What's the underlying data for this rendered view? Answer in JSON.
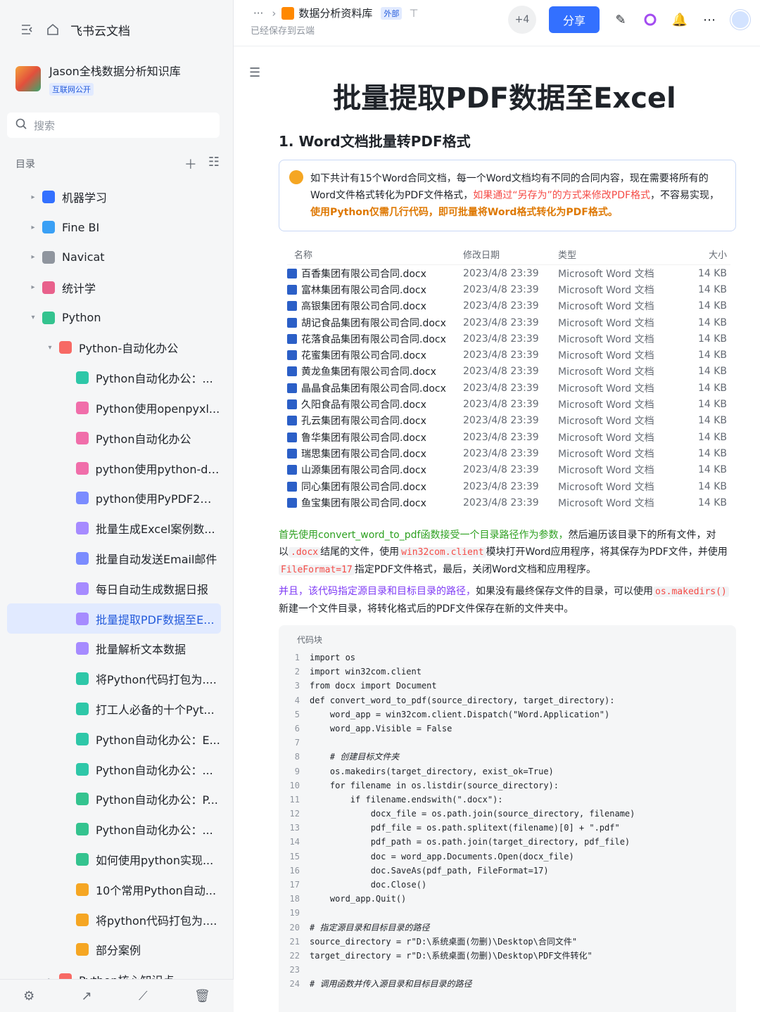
{
  "sidebar": {
    "app_name": "飞书云文档",
    "kb_name": "Jason全栈数据分析知识库",
    "kb_badge": "互联网公开",
    "search_placeholder": "搜索",
    "toc_label": "目录",
    "items": [
      {
        "label": "机器学习",
        "color": "#3370ff",
        "arrow": "▸",
        "depth": 0
      },
      {
        "label": "Fine BI",
        "color": "#3aa0f5",
        "arrow": "▸",
        "depth": 0
      },
      {
        "label": "Navicat",
        "color": "#8f959e",
        "arrow": "▸",
        "depth": 0
      },
      {
        "label": "统计学",
        "color": "#e8618c",
        "arrow": "▸",
        "depth": 0
      },
      {
        "label": "Python",
        "color": "#34c38f",
        "arrow": "▾",
        "depth": 0
      },
      {
        "label": "Python-自动化办公",
        "color": "#f76964",
        "arrow": "▾",
        "depth": 1
      },
      {
        "label": "Python自动化办公：...",
        "color": "#2ec7a8",
        "arrow": "",
        "depth": 2
      },
      {
        "label": "Python使用openpyxl...",
        "color": "#f06eaa",
        "arrow": "",
        "depth": 2
      },
      {
        "label": "Python自动化办公",
        "color": "#f06eaa",
        "arrow": "",
        "depth": 2
      },
      {
        "label": "python使用python-do...",
        "color": "#f06eaa",
        "arrow": "",
        "depth": 2
      },
      {
        "label": "python使用PyPDF2和...",
        "color": "#7b8cff",
        "arrow": "",
        "depth": 2
      },
      {
        "label": "批量生成Excel案例数...",
        "color": "#a68bff",
        "arrow": "",
        "depth": 2
      },
      {
        "label": "批量自动发送Email邮件",
        "color": "#7b8cff",
        "arrow": "",
        "depth": 2
      },
      {
        "label": "每日自动生成数据日报",
        "color": "#a68bff",
        "arrow": "",
        "depth": 2
      },
      {
        "label": "批量提取PDF数据至E...",
        "color": "#a68bff",
        "arrow": "",
        "depth": 2,
        "active": true
      },
      {
        "label": "批量解析文本数据",
        "color": "#a68bff",
        "arrow": "",
        "depth": 2
      },
      {
        "label": "将Python代码打包为....",
        "color": "#2ec7a8",
        "arrow": "",
        "depth": 2
      },
      {
        "label": "打工人必备的十个Pyt...",
        "color": "#2ec7a8",
        "arrow": "",
        "depth": 2
      },
      {
        "label": "Python自动化办公：E...",
        "color": "#2ec7a8",
        "arrow": "",
        "depth": 2
      },
      {
        "label": "Python自动化办公：...",
        "color": "#2ec7a8",
        "arrow": "",
        "depth": 2
      },
      {
        "label": "Python自动化办公：P...",
        "color": "#34c38f",
        "arrow": "",
        "depth": 2
      },
      {
        "label": "Python自动化办公：...",
        "color": "#34c38f",
        "arrow": "",
        "depth": 2
      },
      {
        "label": "如何使用python实现...",
        "color": "#34c38f",
        "arrow": "",
        "depth": 2
      },
      {
        "label": "10个常用Python自动...",
        "color": "#f5a623",
        "arrow": "",
        "depth": 2
      },
      {
        "label": "将python代码打包为....",
        "color": "#f5a623",
        "arrow": "",
        "depth": 2
      },
      {
        "label": "部分案例",
        "color": "#f5a623",
        "arrow": "",
        "depth": 2
      },
      {
        "label": "Python核心知识点",
        "color": "#f76964",
        "arrow": "▸",
        "depth": 1
      }
    ]
  },
  "header": {
    "breadcrumb_dots": "···",
    "doc_title": "数据分析资料库",
    "ext_badge": "外部",
    "saved": "已经保存到云端",
    "collaborators": "+4",
    "share": "分享"
  },
  "doc": {
    "title": "批量提取PDF数据至Excel",
    "h2": "1. Word文档批量转PDF格式",
    "callout": {
      "t1": "如下共计有15个Word合同文档，每一个Word文档均有不同的合同内容，现在需要将所有的Word文件格式转化为PDF文件格式，",
      "t2": "如果通过“另存为”的方式来修改PDF格式",
      "t3": "，不容易实现，",
      "t4": "使用Python仅需几行代码，即可批量将Word格式转化为PDF格式。"
    },
    "file_headers": {
      "name": "名称",
      "date": "修改日期",
      "type": "类型",
      "size": "大小"
    },
    "files": [
      {
        "name": "百香集团有限公司合同.docx",
        "date": "2023/4/8 23:39",
        "type": "Microsoft Word 文档",
        "size": "14 KB"
      },
      {
        "name": "富林集团有限公司合同.docx",
        "date": "2023/4/8 23:39",
        "type": "Microsoft Word 文档",
        "size": "14 KB"
      },
      {
        "name": "高银集团有限公司合同.docx",
        "date": "2023/4/8 23:39",
        "type": "Microsoft Word 文档",
        "size": "14 KB"
      },
      {
        "name": "胡记食品集团有限公司合同.docx",
        "date": "2023/4/8 23:39",
        "type": "Microsoft Word 文档",
        "size": "14 KB"
      },
      {
        "name": "花落食品集团有限公司合同.docx",
        "date": "2023/4/8 23:39",
        "type": "Microsoft Word 文档",
        "size": "14 KB"
      },
      {
        "name": "花蜜集团有限公司合同.docx",
        "date": "2023/4/8 23:39",
        "type": "Microsoft Word 文档",
        "size": "14 KB"
      },
      {
        "name": "黄龙鱼集团有限公司合同.docx",
        "date": "2023/4/8 23:39",
        "type": "Microsoft Word 文档",
        "size": "14 KB"
      },
      {
        "name": "晶晶食品集团有限公司合同.docx",
        "date": "2023/4/8 23:39",
        "type": "Microsoft Word 文档",
        "size": "14 KB"
      },
      {
        "name": "久阳食品有限公司合同.docx",
        "date": "2023/4/8 23:39",
        "type": "Microsoft Word 文档",
        "size": "14 KB"
      },
      {
        "name": "孔云集团有限公司合同.docx",
        "date": "2023/4/8 23:39",
        "type": "Microsoft Word 文档",
        "size": "14 KB"
      },
      {
        "name": "鲁华集团有限公司合同.docx",
        "date": "2023/4/8 23:39",
        "type": "Microsoft Word 文档",
        "size": "14 KB"
      },
      {
        "name": "瑞思集团有限公司合同.docx",
        "date": "2023/4/8 23:39",
        "type": "Microsoft Word 文档",
        "size": "14 KB"
      },
      {
        "name": "山源集团有限公司合同.docx",
        "date": "2023/4/8 23:39",
        "type": "Microsoft Word 文档",
        "size": "14 KB"
      },
      {
        "name": "同心集团有限公司合同.docx",
        "date": "2023/4/8 23:39",
        "type": "Microsoft Word 文档",
        "size": "14 KB"
      },
      {
        "name": "鱼宝集团有限公司合同.docx",
        "date": "2023/4/8 23:39",
        "type": "Microsoft Word 文档",
        "size": "14 KB"
      }
    ],
    "p1": {
      "a": "首先使用convert_word_to_pdf函数接受一个目录路径作为参数，",
      "b": "然后遍历该目录下的所有文件，对以",
      "c1": ".docx",
      "b2": "结尾的文件，使用",
      "c2": "win32com.client",
      "b3": "模块打开Word应用程序，将其保存为PDF文件，并使用",
      "c3": "FileFormat=17",
      "b4": "指定PDF文件格式，最后，关闭Word文档和应用程序。"
    },
    "p2": {
      "a": "并且，该代码指定源目录和目标目录的路径，",
      "b": "如果没有最终保存文件的目录，可以使用",
      "c1": "os.makedirs()",
      "b2": "新建一个文件目录，将转化格式后的PDF文件保存在新的文件夹中。"
    },
    "code_label": "代码块",
    "code_lines": [
      "import os",
      "import win32com.client",
      "from docx import Document",
      "def convert_word_to_pdf(source_directory, target_directory):",
      "    word_app = win32com.client.Dispatch(\"Word.Application\")",
      "    word_app.Visible = False",
      "",
      "    # 创建目标文件夹",
      "    os.makedirs(target_directory, exist_ok=True)",
      "    for filename in os.listdir(source_directory):",
      "        if filename.endswith(\".docx\"):",
      "            docx_file = os.path.join(source_directory, filename)",
      "            pdf_file = os.path.splitext(filename)[0] + \".pdf\"",
      "            pdf_path = os.path.join(target_directory, pdf_file)",
      "            doc = word_app.Documents.Open(docx_file)",
      "            doc.SaveAs(pdf_path, FileFormat=17)",
      "            doc.Close()",
      "    word_app.Quit()",
      "",
      "# 指定源目录和目标目录的路径",
      "source_directory = r\"D:\\系统桌面(勿删)\\Desktop\\合同文件\"",
      "target_directory = r\"D:\\系统桌面(勿删)\\Desktop\\PDF文件转化\"",
      "",
      "# 调用函数并传入源目录和目标目录的路径"
    ]
  }
}
